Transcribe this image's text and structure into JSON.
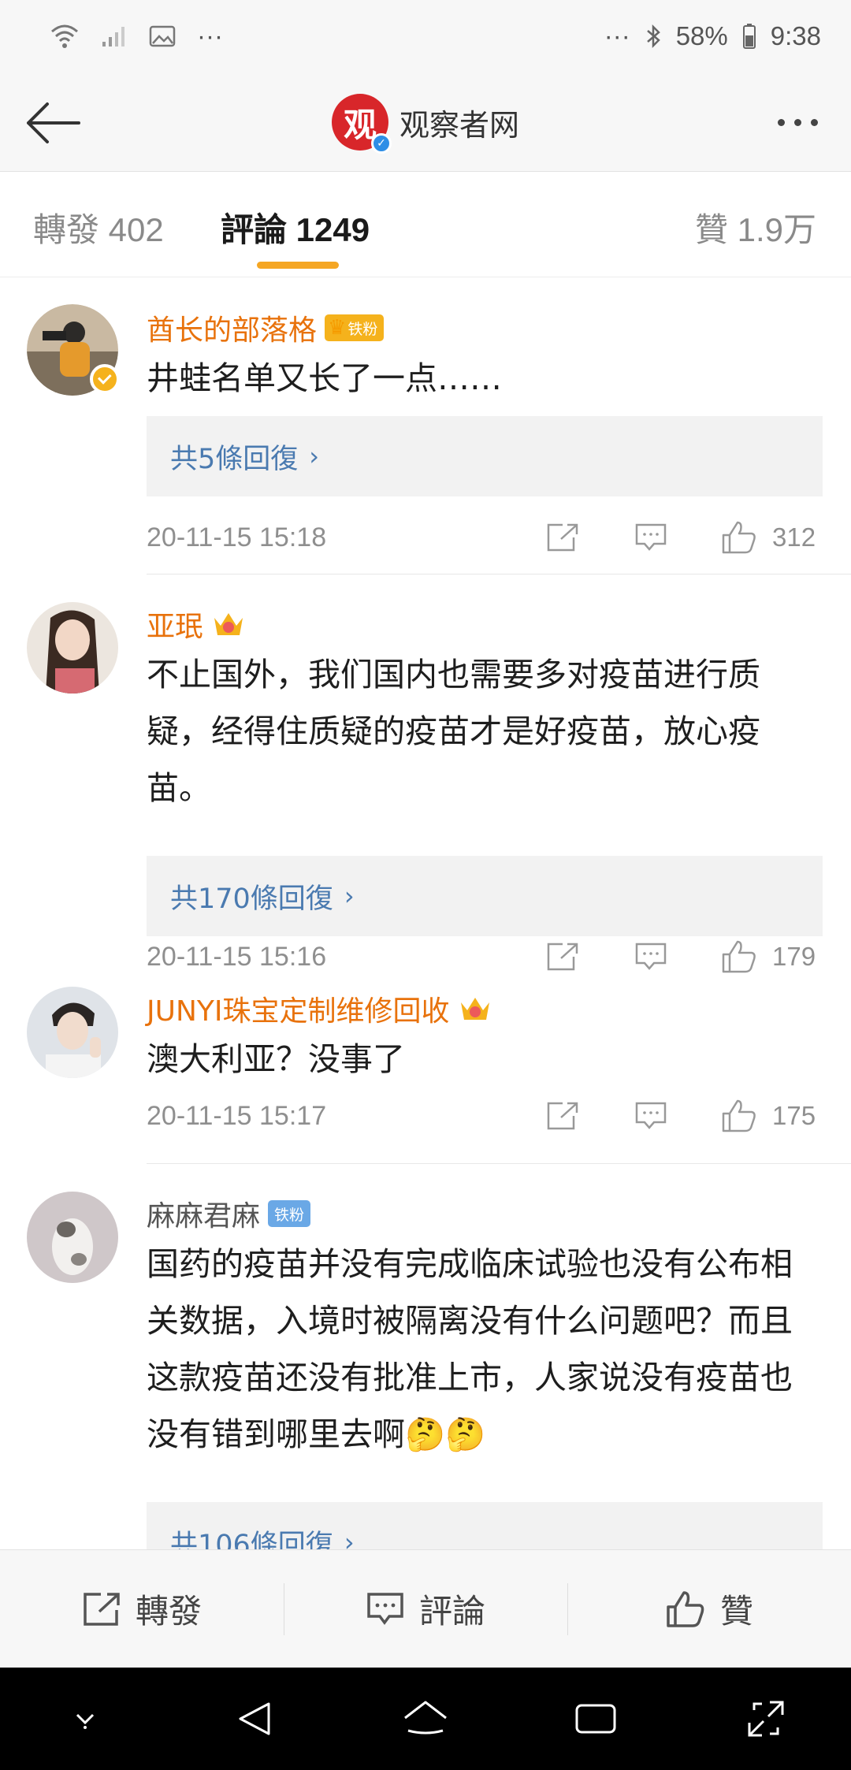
{
  "status_bar": {
    "battery": "58%",
    "time": "9:38",
    "left_more": "···",
    "right_more": "···"
  },
  "header": {
    "title": "观察者网",
    "logo_char": "观"
  },
  "tabs": {
    "repost": "轉發 402",
    "comment": "評論 1249",
    "like": "贊 1.9万"
  },
  "comments": [
    {
      "username": "酋长的部落格",
      "badge": "铁粉",
      "text": "井蛙名单又长了一点……",
      "replies": "共5條回復",
      "time": "20-11-15 15:18",
      "likes": "312"
    },
    {
      "username": "亚珉",
      "text": "不止国外，我们国内也需要多对疫苗进行质疑，经得住质疑的疫苗才是好疫苗，放心疫苗。",
      "replies": "共170條回復",
      "time": "20-11-15 15:16",
      "likes": "179"
    },
    {
      "username": "JUNYI珠宝定制维修回收",
      "text": "澳大利亚？没事了",
      "time": "20-11-15 15:17",
      "likes": "175"
    },
    {
      "username": "麻麻君麻",
      "badge": "铁粉",
      "text": "国药的疫苗并没有完成临床试验也没有公布相关数据，入境时被隔离没有什么问题吧？而且这款疫苗还没有批准上市，人家说没有疫苗也没有错到哪里去啊🤔🤔",
      "replies": "共106條回復"
    }
  ],
  "actions": {
    "repost": "轉發",
    "comment": "評論",
    "like": "贊"
  },
  "colors": {
    "username": "#e8720c",
    "accent": "#f5a623",
    "reply_link": "#4a7ab0"
  }
}
